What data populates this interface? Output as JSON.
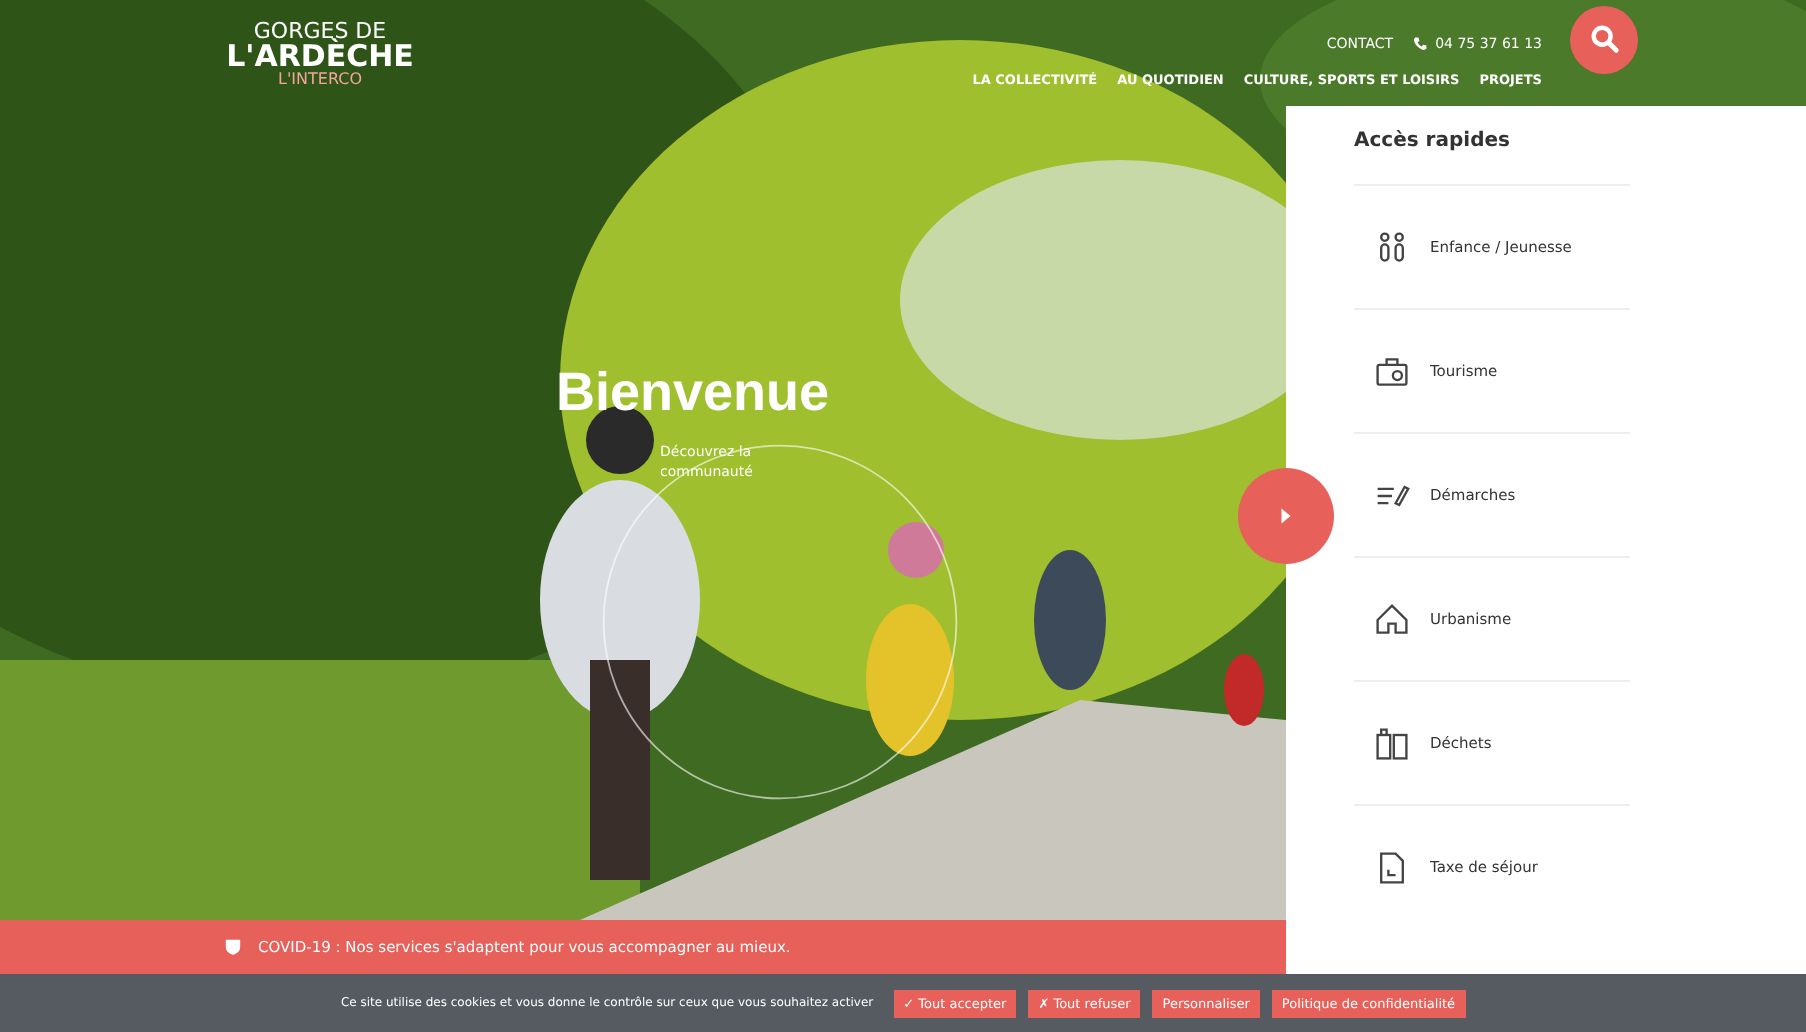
{
  "logo": {
    "line_1": "GORGES DE",
    "line_2": "L'ARDÈCHE",
    "line_3": "L'INTERCO"
  },
  "top_links": {
    "contact": "CONTACT",
    "phone": "04 75 37 61 13"
  },
  "nav": [
    "LA COLLECTIVITÉ",
    "AU QUOTIDIEN",
    "CULTURE, SPORTS ET LOISIRS",
    "PROJETS"
  ],
  "hero": {
    "kind": "picture",
    "title": "Bienvenue",
    "subtitle": "Découvrez la communauté"
  },
  "quick_access": {
    "title": "Accès rapides",
    "items": [
      {
        "label": "Enfance / Jeunesse",
        "kind": "children"
      },
      {
        "label": "Tourisme",
        "kind": "tourism"
      },
      {
        "label": "Démarches",
        "kind": "forms"
      },
      {
        "label": "Urbanisme",
        "kind": "house"
      },
      {
        "label": "Déchets",
        "kind": "bins"
      },
      {
        "label": "Taxe de séjour",
        "kind": "document"
      }
    ]
  },
  "alert": {
    "text": "COVID-19 : Nos services s'adaptent pour vous accompagner au mieux."
  },
  "cookie_bar": {
    "text": "Ce site utilise des cookies et vous donne le contrôle sur ceux que vous souhaitez activer",
    "buttons": [
      "✓ Tout accepter",
      "✗ Tout refuser",
      "Personnaliser",
      "Politique de confidentialité"
    ]
  }
}
